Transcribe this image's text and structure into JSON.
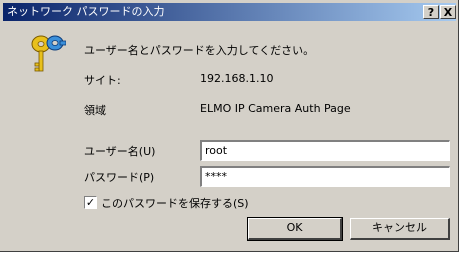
{
  "window": {
    "title": "ネットワーク パスワードの入力",
    "help_label": "?",
    "close_label": "X"
  },
  "prompt": "ユーザー名とパスワードを入力してください。",
  "site": {
    "label": "サイト:",
    "value": "192.168.1.10"
  },
  "realm": {
    "label": "領域",
    "value": "ELMO IP Camera Auth Page"
  },
  "username": {
    "label": "ユーザー名(U)",
    "value": "root"
  },
  "password": {
    "label": "パスワード(P)",
    "value": "****"
  },
  "save_password": {
    "label": "このパスワードを保存する(S)",
    "checked_mark": "✓"
  },
  "buttons": {
    "ok": "OK",
    "cancel": "キャンセル"
  },
  "icon": "keys-icon"
}
